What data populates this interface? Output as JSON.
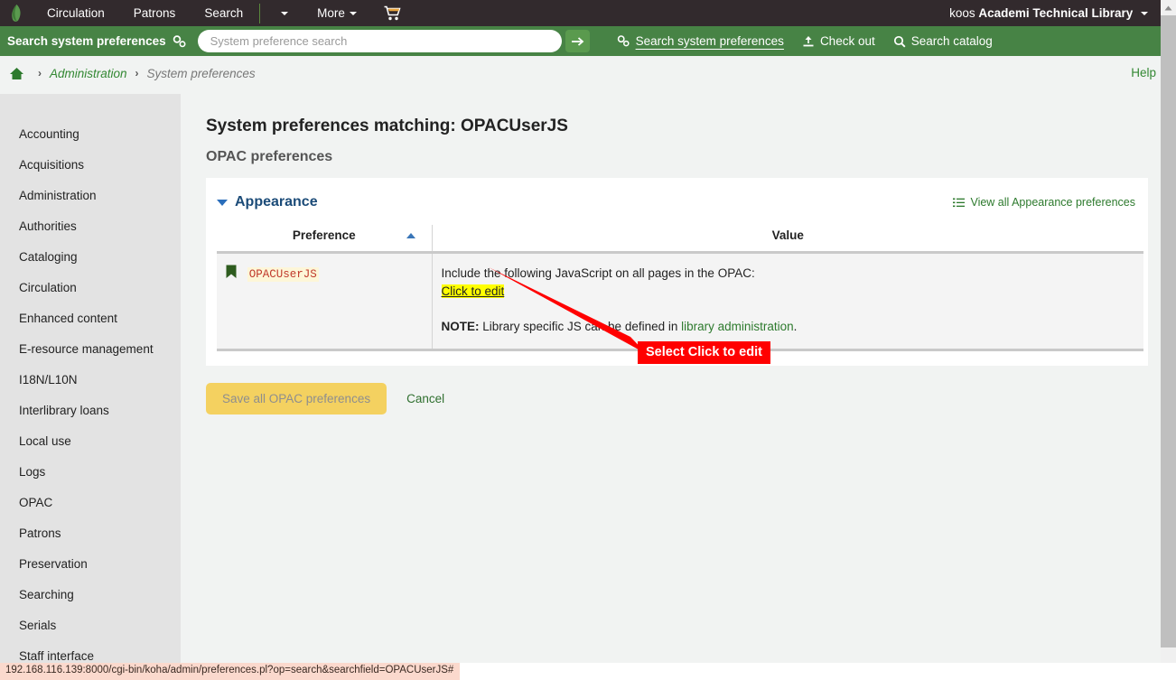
{
  "topnav": {
    "logo_icon": "koha-leaf-logo",
    "items": [
      {
        "label": "Circulation",
        "icon": null
      },
      {
        "label": "Patrons",
        "icon": null
      },
      {
        "label": "Search",
        "icon": null
      }
    ],
    "search_caret_icon": "chevron-down-icon",
    "more_label": "More",
    "more_caret_icon": "chevron-down-icon",
    "cart_icon": "shopping-cart-icon",
    "user_name": "koos",
    "library_name": "Academi Technical Library",
    "user_caret_icon": "chevron-down-icon"
  },
  "searchbar": {
    "label": "Search system preferences",
    "label_icon": "gears-icon",
    "placeholder": "System preference search",
    "value": "",
    "submit_icon": "arrow-right-icon",
    "links": [
      {
        "label": "Search system preferences",
        "icon": "gears-icon",
        "active": true
      },
      {
        "label": "Check out",
        "icon": "check-out-icon",
        "active": false
      },
      {
        "label": "Search catalog",
        "icon": "search-icon",
        "active": false
      }
    ]
  },
  "breadcrumb": {
    "home_icon": "home-icon",
    "separator": "›",
    "items": [
      {
        "label": "Administration",
        "link": true
      },
      {
        "label": "System preferences",
        "link": false
      }
    ],
    "help_label": "Help"
  },
  "sidebar": {
    "items": [
      {
        "label": "Accounting"
      },
      {
        "label": "Acquisitions"
      },
      {
        "label": "Administration"
      },
      {
        "label": "Authorities"
      },
      {
        "label": "Cataloging"
      },
      {
        "label": "Circulation"
      },
      {
        "label": "Enhanced content"
      },
      {
        "label": "E-resource management"
      },
      {
        "label": "I18N/L10N"
      },
      {
        "label": "Interlibrary loans"
      },
      {
        "label": "Local use"
      },
      {
        "label": "Logs"
      },
      {
        "label": "OPAC"
      },
      {
        "label": "Patrons"
      },
      {
        "label": "Preservation"
      },
      {
        "label": "Searching"
      },
      {
        "label": "Serials"
      },
      {
        "label": "Staff interface"
      }
    ]
  },
  "main": {
    "page_title": "System preferences matching: OPACUserJS",
    "sub_title": "OPAC preferences",
    "group": {
      "title": "Appearance",
      "collapse_icon": "triangle-down-icon",
      "view_all_label": "View all Appearance preferences",
      "view_all_icon": "list-icon"
    },
    "table": {
      "columns": [
        "Preference",
        "Value"
      ],
      "sort_icon": "sort-ascending-icon",
      "rows": [
        {
          "flag_icon": "bookmark-flag-icon",
          "preference": "OPACUserJS",
          "value_intro": "Include the following JavaScript on all pages in the OPAC:",
          "edit_link": "Click to edit",
          "note_label": "NOTE:",
          "note_text_before": " Library specific JS can be defined in ",
          "note_link": "library administration",
          "note_text_after": "."
        }
      ]
    },
    "save_label": "Save all OPAC preferences",
    "cancel_label": "Cancel"
  },
  "annotation": {
    "label": "Select Click to edit",
    "box_color": "#ff0000",
    "text_color": "#ffffff",
    "arrow_color": "#ff0000"
  },
  "statusbar": {
    "url": "192.168.116.139:8000/cgi-bin/koha/admin/preferences.pl?op=search&searchfield=OPACUserJS#"
  },
  "scrollbar": {
    "up_arrow_icon": "triangle-up-icon"
  },
  "colors": {
    "topnav_bg": "#322a2d",
    "searchbar_bg": "#478345",
    "accent_green": "#2d7a2d",
    "group_title_blue": "#1b4b78",
    "highlight_yellow": "#ffff00",
    "pref_name_red": "#c0392b",
    "save_button_yellow": "#f4d160"
  }
}
